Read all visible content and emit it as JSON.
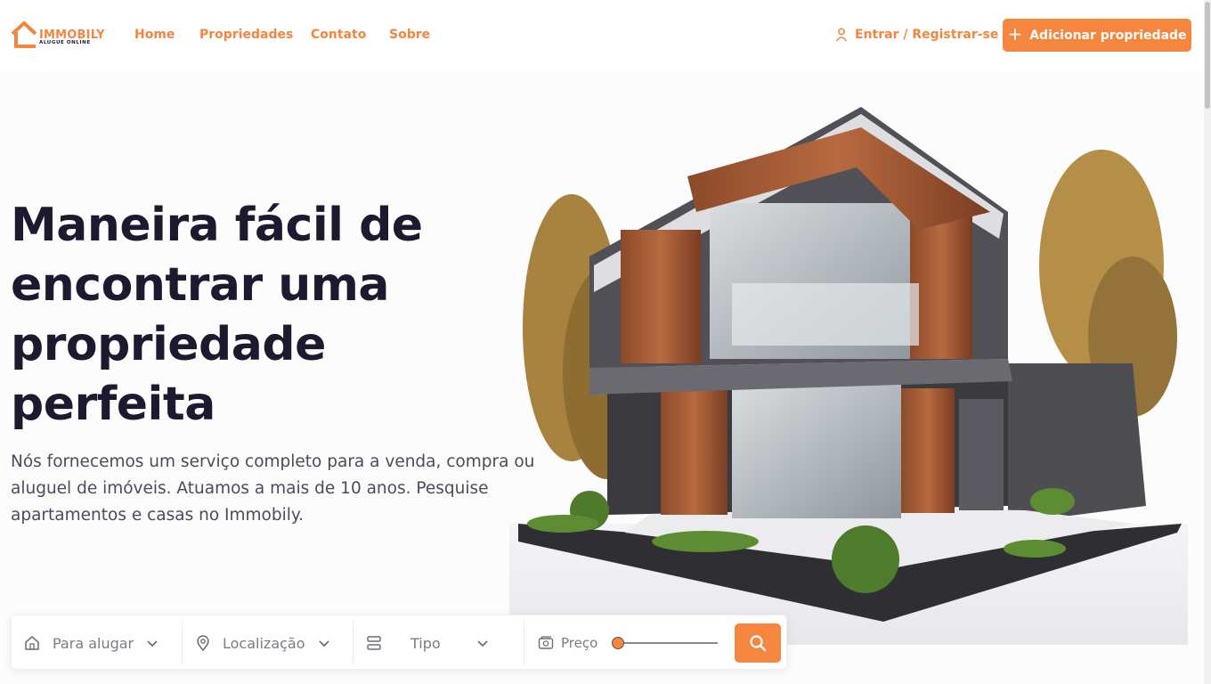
{
  "brand": {
    "name": "IMMOBILY",
    "tagline": "ALUGUE ONLINE",
    "accent": "#f5863f",
    "dark": "#1b1a2e"
  },
  "nav": [
    {
      "label": "Home"
    },
    {
      "label": "Propriedades"
    },
    {
      "label": "Contato"
    },
    {
      "label": "Sobre"
    }
  ],
  "header": {
    "login_label": "Entrar / Registrar-se",
    "login_icon": "user-icon",
    "add_label": "Adicionar propriedade",
    "add_icon": "plus-icon"
  },
  "hero": {
    "title": "Maneira fácil de encontrar uma propriedade perfeita",
    "subtitle": "Nós fornecemos um serviço completo para a venda, compra ou aluguel de imóveis. Atuamos a mais de 10 anos. Pesquise apartamentos e casas no Immobily."
  },
  "search": {
    "purpose": {
      "icon": "home-icon",
      "value": "Para alugar"
    },
    "location": {
      "icon": "map-pin-icon",
      "value": "Localização"
    },
    "type": {
      "icon": "layers-icon",
      "value": "Tipo"
    },
    "price": {
      "icon": "money-icon",
      "label": "Preço",
      "slider_fraction": 0.0
    },
    "button_icon": "search-icon"
  }
}
